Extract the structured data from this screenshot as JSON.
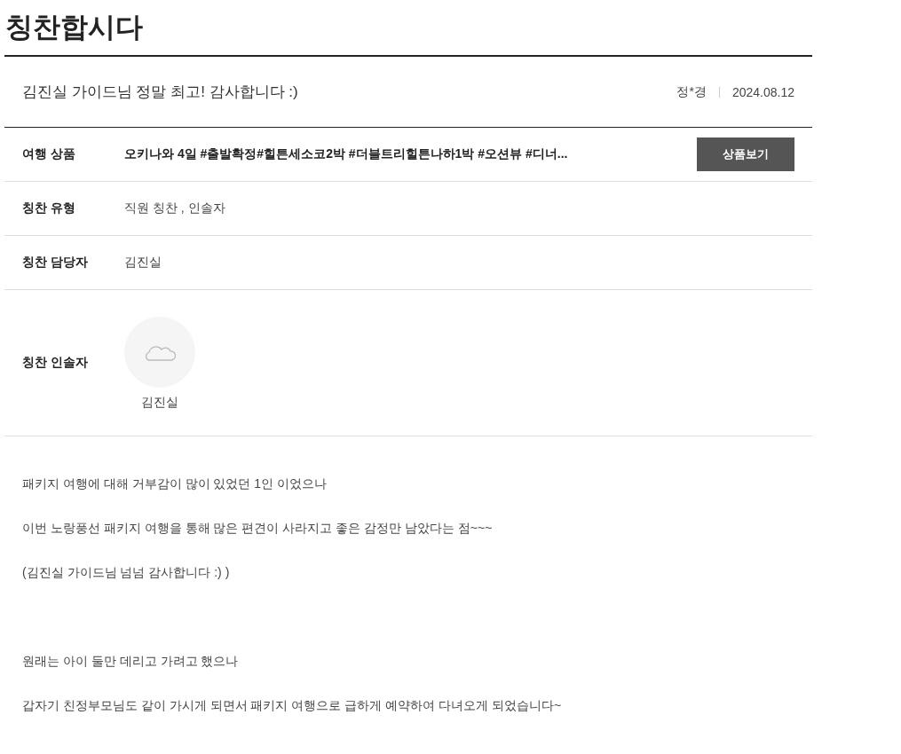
{
  "page_title": "칭찬합시다",
  "post": {
    "title": "김진실 가이드님 정말 최고! 감사합니다 :)",
    "author": "정*경",
    "date": "2024.08.12"
  },
  "rows": [
    {
      "kind": "product",
      "label": "여행 상품",
      "value": "오키나와 4일 #출발확정#힐튼세소코2박 #더블트리힐튼나하1박 #오션뷰 #디너...",
      "button": "상품보기"
    },
    {
      "kind": "text",
      "label": "칭찬 유형",
      "value": "직원 칭찬 , 인솔자"
    },
    {
      "kind": "text",
      "label": "칭찬 담당자",
      "value": "김진실"
    },
    {
      "kind": "person",
      "label": "칭찬 인솔자",
      "value": "김진실"
    }
  ],
  "body": [
    [
      "패키지 여행에 대해 거부감이 많이 있었던 1인 이었으나",
      "이번 노랑풍선 패키지 여행을 통해 많은 편견이 사라지고 좋은 감정만 남았다는 점~~~",
      "(김진실 가이드님 넘넘 감사합니다 :) )"
    ],
    [
      "원래는 아이 둘만 데리고 가려고 했으나",
      "갑자기 친정부모님도 같이 가시게 되면서 패키지 여행으로 급하게 예약하여 다녀오게 되었습니다~"
    ]
  ]
}
